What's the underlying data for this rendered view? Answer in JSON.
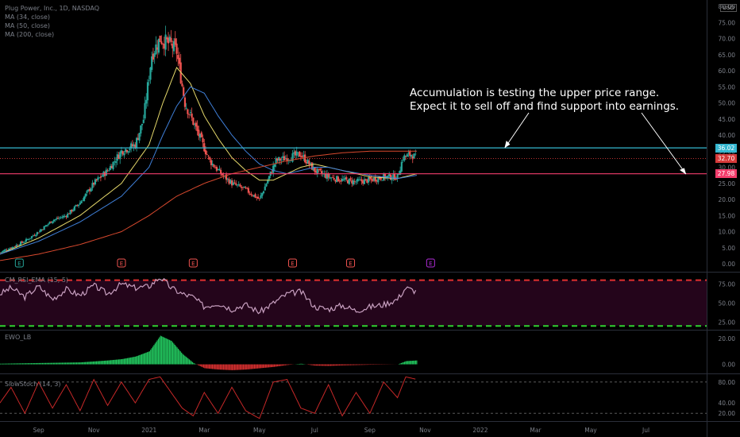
{
  "header": {
    "symbol_line": "Plug Power, Inc., 1D, NASDAQ",
    "ma_labels": [
      "MA (34, close)",
      "MA (50, close)",
      "MA (200, close)"
    ],
    "currency": "USD"
  },
  "annotation": {
    "line1": "Accumulation is testing the upper price range.",
    "line2": "Expect it to sell off and find support into earnings."
  },
  "price_tags": {
    "resistance": "36.02",
    "last": "32.70",
    "support": "27.98"
  },
  "colors": {
    "resistance": "#35b7d0",
    "support": "#f23d6c",
    "last": "#d63a3a",
    "bull": "#26a69a",
    "bear": "#ef5350",
    "ma34": "#e6d96b",
    "ma50": "#3f7fd8",
    "ma200": "#d8492e",
    "rsi": "#c8a0c0",
    "rsi_band": "#e0302f",
    "rsi_band_low": "#2fd12f",
    "ewo_pos": "#22c55e",
    "ewo_neg": "#d32f2f",
    "stoch": "#c62828"
  },
  "indicators": {
    "rsi_label": "CM_RSI_EMA (15, 5)",
    "ewo_label": "EWO_LB",
    "stoch_label": "SlowStoch (14, 3)"
  },
  "chart_data": [
    {
      "type": "candlestick",
      "title": "Plug Power, Inc., 1D, NASDAQ",
      "ylim": [
        0,
        80
      ],
      "y_ticks": [
        "0.00",
        "5.00",
        "10.00",
        "15.00",
        "20.00",
        "25.00",
        "30.00",
        "35.00",
        "40.00",
        "45.00",
        "50.00",
        "55.00",
        "60.00",
        "65.00",
        "70.00",
        "75.00",
        "80.00"
      ],
      "x_ticks": [
        "Sep",
        "Nov",
        "2021",
        "Mar",
        "May",
        "Jul",
        "Sep",
        "Nov",
        "2022",
        "Mar",
        "May",
        "Jul"
      ],
      "x_tick_months": [
        2.0,
        4.0,
        6.0,
        8.0,
        10.0,
        12.0,
        14.0,
        16.0,
        18.0,
        20.0,
        22.0,
        24.0
      ],
      "xlim_months": [
        0.6,
        26.2
      ],
      "series": [
        {
          "kind": "close",
          "x_months": [
            0.6,
            1.0,
            1.5,
            2.0,
            2.5,
            3.0,
            3.5,
            4.0,
            4.5,
            5.0,
            5.5,
            5.8,
            6.1,
            6.4,
            6.8,
            7.0,
            7.3,
            7.6,
            7.9,
            8.2,
            8.6,
            9.0,
            9.5,
            10.0,
            10.3,
            10.6,
            11.0,
            11.5,
            12.0,
            12.5,
            13.0,
            13.5,
            14.0,
            14.5,
            15.0,
            15.2,
            15.5,
            15.7
          ],
          "close": [
            3.5,
            5.0,
            7.0,
            10.0,
            13.5,
            15.0,
            19.0,
            25.0,
            29.0,
            35.0,
            37.0,
            45.0,
            65.0,
            70.0,
            68.0,
            66.0,
            50.0,
            44.0,
            38.0,
            32.0,
            28.0,
            25.0,
            23.0,
            20.0,
            26.0,
            32.0,
            33.0,
            34.0,
            29.0,
            27.0,
            26.0,
            25.5,
            26.0,
            27.0,
            27.0,
            33.0,
            34.0,
            32.7
          ]
        },
        {
          "name": "MA (34, close)",
          "x_months": [
            0.6,
            2.0,
            3.5,
            5.0,
            6.0,
            6.5,
            7.0,
            7.5,
            8.0,
            8.5,
            9.0,
            9.5,
            10.0,
            10.5,
            11.0,
            11.5,
            12.0,
            12.5,
            13.0,
            14.0,
            15.0,
            15.7
          ],
          "y": [
            3,
            8,
            15,
            25,
            37,
            50,
            61,
            56,
            46,
            39,
            33,
            29,
            26,
            26,
            28,
            30,
            31,
            30,
            29,
            27,
            26.5,
            28
          ]
        },
        {
          "name": "MA (50, close)",
          "x_months": [
            0.6,
            2.0,
            3.5,
            5.0,
            6.0,
            6.5,
            7.0,
            7.5,
            8.0,
            8.5,
            9.0,
            9.5,
            10.0,
            10.5,
            11.0,
            11.5,
            12.0,
            12.5,
            13.0,
            14.0,
            15.0,
            15.7
          ],
          "y": [
            3,
            7,
            13,
            21,
            30,
            40,
            49,
            55,
            53,
            46,
            40,
            35,
            31,
            29,
            28,
            29,
            30,
            30,
            29,
            27.5,
            26.5,
            27.5
          ]
        },
        {
          "name": "MA (200, close)",
          "x_months": [
            0.6,
            2.0,
            3.5,
            5.0,
            6.0,
            6.5,
            7.0,
            8.0,
            9.0,
            10.0,
            11.0,
            12.0,
            13.0,
            14.0,
            15.0,
            15.7
          ],
          "y": [
            1,
            3,
            6,
            10,
            15,
            18,
            21,
            25,
            28,
            30,
            32,
            33.5,
            34.5,
            35,
            35,
            35
          ]
        }
      ],
      "horizontal_lines": [
        {
          "value": 36.02,
          "label": "36.02",
          "color": "#35b7d0"
        },
        {
          "value": 27.98,
          "label": "27.98",
          "color": "#f23d6c"
        },
        {
          "value": 32.7,
          "label": "32.70",
          "color": "#d63a3a",
          "style": "dotted"
        }
      ],
      "earnings_markers": [
        {
          "x_month": 1.3,
          "label": "E",
          "color": "#26a69a"
        },
        {
          "x_month": 5.0,
          "label": "E",
          "color": "#ef5350"
        },
        {
          "x_month": 7.6,
          "label": "E",
          "color": "#ef5350"
        },
        {
          "x_month": 11.2,
          "label": "E",
          "color": "#ef5350"
        },
        {
          "x_month": 13.3,
          "label": "E",
          "color": "#ef5350"
        },
        {
          "x_month": 16.2,
          "label": "E",
          "color": "#b02cd8"
        }
      ]
    },
    {
      "type": "line",
      "title": "CM_RSI_EMA (15, 5)",
      "ylim": [
        15,
        90
      ],
      "y_ticks": [
        "25.00",
        "50.00",
        "75.00"
      ],
      "bands": [
        80,
        20
      ],
      "series": [
        {
          "x_months": [
            0.6,
            1.0,
            1.5,
            2.0,
            2.5,
            3.0,
            3.5,
            4.0,
            4.5,
            5.0,
            5.5,
            6.0,
            6.4,
            6.8,
            7.2,
            7.6,
            8.0,
            8.5,
            9.0,
            9.5,
            10.0,
            10.5,
            11.0,
            11.5,
            12.0,
            12.5,
            13.0,
            13.5,
            14.0,
            14.5,
            15.0,
            15.3,
            15.7
          ],
          "y": [
            62,
            70,
            58,
            72,
            55,
            68,
            60,
            73,
            62,
            75,
            70,
            72,
            84,
            70,
            62,
            58,
            45,
            50,
            42,
            48,
            38,
            50,
            62,
            65,
            45,
            42,
            47,
            40,
            45,
            48,
            55,
            70,
            65
          ]
        }
      ]
    },
    {
      "type": "bar",
      "title": "EWO_LB",
      "ylim": [
        -7,
        26
      ],
      "y_ticks": [
        "0.00",
        "20.00"
      ],
      "series": [
        {
          "x_months": [
            0.6,
            2.0,
            3.5,
            4.5,
            5.0,
            5.5,
            6.0,
            6.4,
            6.8,
            7.2,
            7.6,
            8.0,
            8.5,
            9.0,
            9.5,
            10.0,
            10.5,
            11.0,
            11.5,
            12.0,
            12.5,
            13.0,
            14.0,
            15.0,
            15.3,
            15.7
          ],
          "y": [
            0.5,
            1.0,
            1.5,
            3.0,
            4.0,
            6.0,
            10.0,
            22.0,
            18.0,
            8.0,
            1.0,
            -3.0,
            -4.0,
            -4.5,
            -4.0,
            -3.0,
            -2.0,
            -0.5,
            0.5,
            -1.0,
            -1.2,
            -0.8,
            -0.3,
            0.0,
            2.5,
            3.0
          ]
        }
      ]
    },
    {
      "type": "line",
      "title": "SlowStoch (14, 3)",
      "ylim": [
        5,
        95
      ],
      "y_ticks": [
        "20.00",
        "40.00",
        "80.00"
      ],
      "bands": [
        80,
        20
      ],
      "series": [
        {
          "x_months": [
            0.6,
            1.0,
            1.5,
            2.0,
            2.5,
            3.0,
            3.5,
            4.0,
            4.5,
            5.0,
            5.5,
            6.0,
            6.4,
            6.8,
            7.2,
            7.6,
            8.0,
            8.5,
            9.0,
            9.5,
            10.0,
            10.5,
            11.0,
            11.5,
            12.0,
            12.5,
            13.0,
            13.5,
            14.0,
            14.5,
            15.0,
            15.3,
            15.7
          ],
          "y": [
            40,
            70,
            20,
            80,
            30,
            75,
            25,
            85,
            35,
            80,
            40,
            85,
            90,
            60,
            30,
            15,
            60,
            20,
            70,
            25,
            10,
            80,
            85,
            30,
            20,
            75,
            15,
            60,
            20,
            80,
            50,
            90,
            85
          ]
        }
      ]
    }
  ]
}
